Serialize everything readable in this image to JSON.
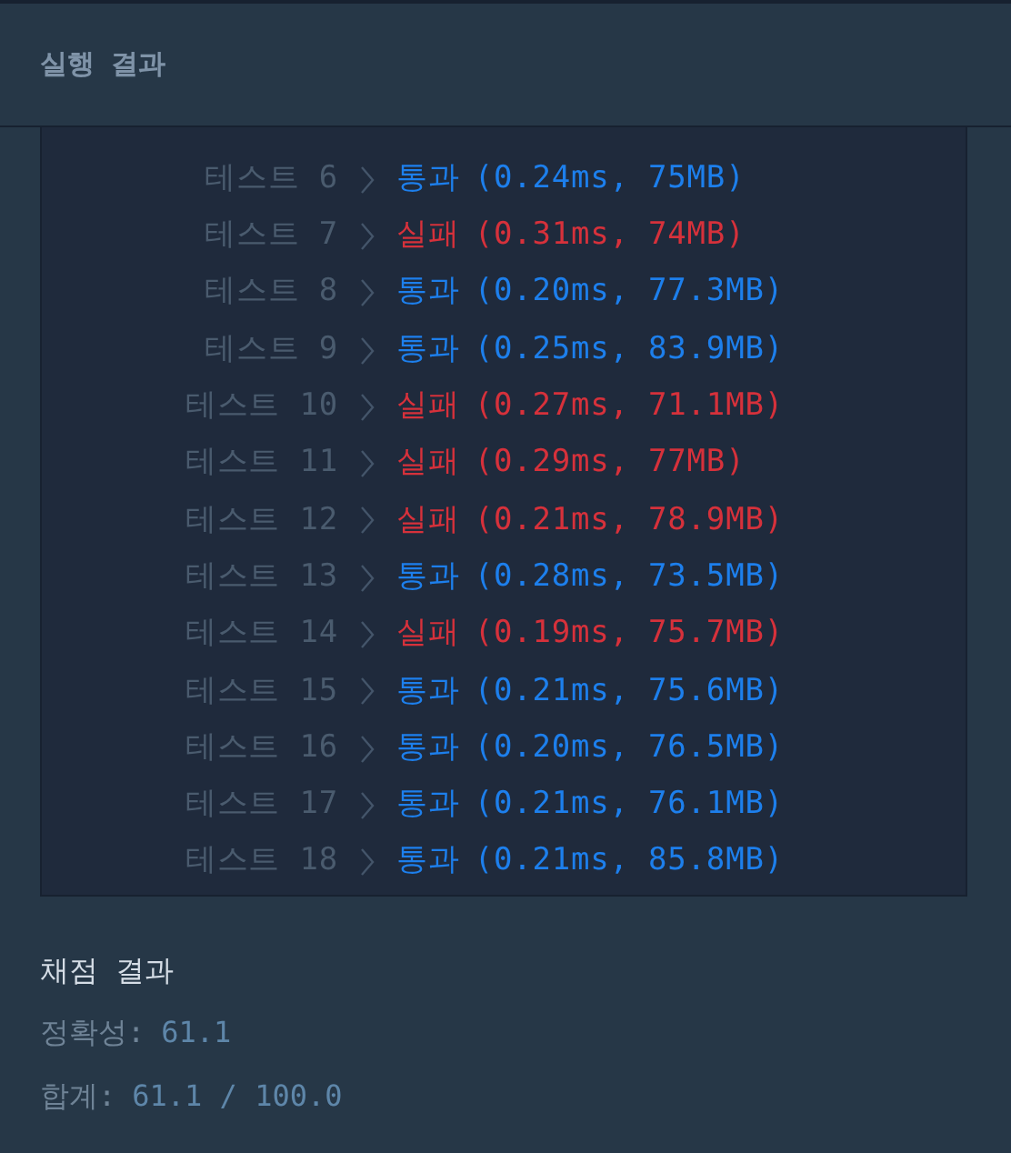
{
  "header": {
    "title": "실행 결과"
  },
  "tests": [
    {
      "label": "테스트 6",
      "status": "통과",
      "detail": "(0.24ms, 75MB)",
      "passed": true
    },
    {
      "label": "테스트 7",
      "status": "실패",
      "detail": "(0.31ms, 74MB)",
      "passed": false
    },
    {
      "label": "테스트 8",
      "status": "통과",
      "detail": "(0.20ms, 77.3MB)",
      "passed": true
    },
    {
      "label": "테스트 9",
      "status": "통과",
      "detail": "(0.25ms, 83.9MB)",
      "passed": true
    },
    {
      "label": "테스트 10",
      "status": "실패",
      "detail": "(0.27ms, 71.1MB)",
      "passed": false
    },
    {
      "label": "테스트 11",
      "status": "실패",
      "detail": "(0.29ms, 77MB)",
      "passed": false
    },
    {
      "label": "테스트 12",
      "status": "실패",
      "detail": "(0.21ms, 78.9MB)",
      "passed": false
    },
    {
      "label": "테스트 13",
      "status": "통과",
      "detail": "(0.28ms, 73.5MB)",
      "passed": true
    },
    {
      "label": "테스트 14",
      "status": "실패",
      "detail": "(0.19ms, 75.7MB)",
      "passed": false
    },
    {
      "label": "테스트 15",
      "status": "통과",
      "detail": "(0.21ms, 75.6MB)",
      "passed": true
    },
    {
      "label": "테스트 16",
      "status": "통과",
      "detail": "(0.20ms, 76.5MB)",
      "passed": true
    },
    {
      "label": "테스트 17",
      "status": "통과",
      "detail": "(0.21ms, 76.1MB)",
      "passed": true
    },
    {
      "label": "테스트 18",
      "status": "통과",
      "detail": "(0.21ms, 85.8MB)",
      "passed": true
    }
  ],
  "grading": {
    "title": "채점 결과",
    "lines": [
      {
        "label": "정확성:",
        "value": "61.1"
      },
      {
        "label": "합계:",
        "value": "61.1 / 100.0"
      }
    ]
  }
}
